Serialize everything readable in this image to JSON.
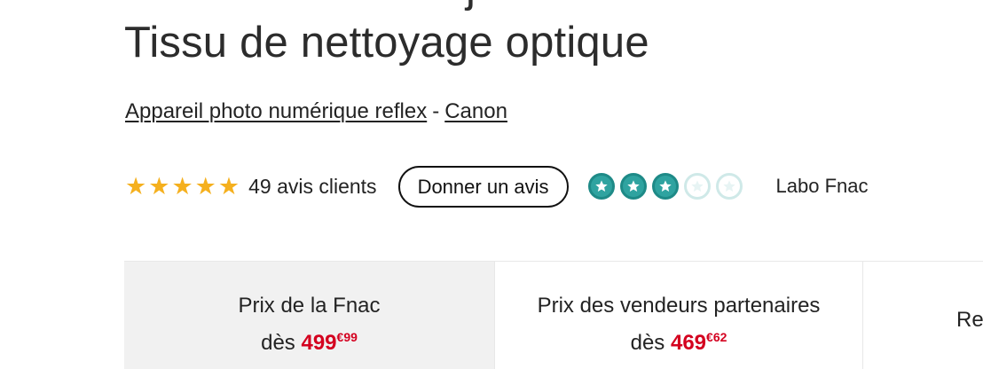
{
  "product": {
    "title_cut_top": "j",
    "title": "Tissu de nettoyage optique"
  },
  "breadcrumb": {
    "category": "Appareil photo numérique reflex",
    "separator": "-",
    "brand": "Canon"
  },
  "rating": {
    "stars": 5,
    "reviews_text": "49 avis clients",
    "review_button": "Donner un avis",
    "labo_score": 3,
    "labo_max": 5,
    "labo_label": "Labo Fnac",
    "colors": {
      "star": "#f5b01e",
      "labo_on": "#2fa3a0",
      "labo_off": "#cfe9e8"
    }
  },
  "price_tabs": [
    {
      "label": "Prix de la Fnac",
      "from": "dès",
      "price_main": "499",
      "price_cents": "€99"
    },
    {
      "label": "Prix des vendeurs partenaires",
      "from": "dès",
      "price_main": "469",
      "price_cents": "€62"
    },
    {
      "label": "Re"
    }
  ],
  "colors": {
    "price": "#d4001f",
    "active_tab_bg": "#f1f1f1"
  }
}
